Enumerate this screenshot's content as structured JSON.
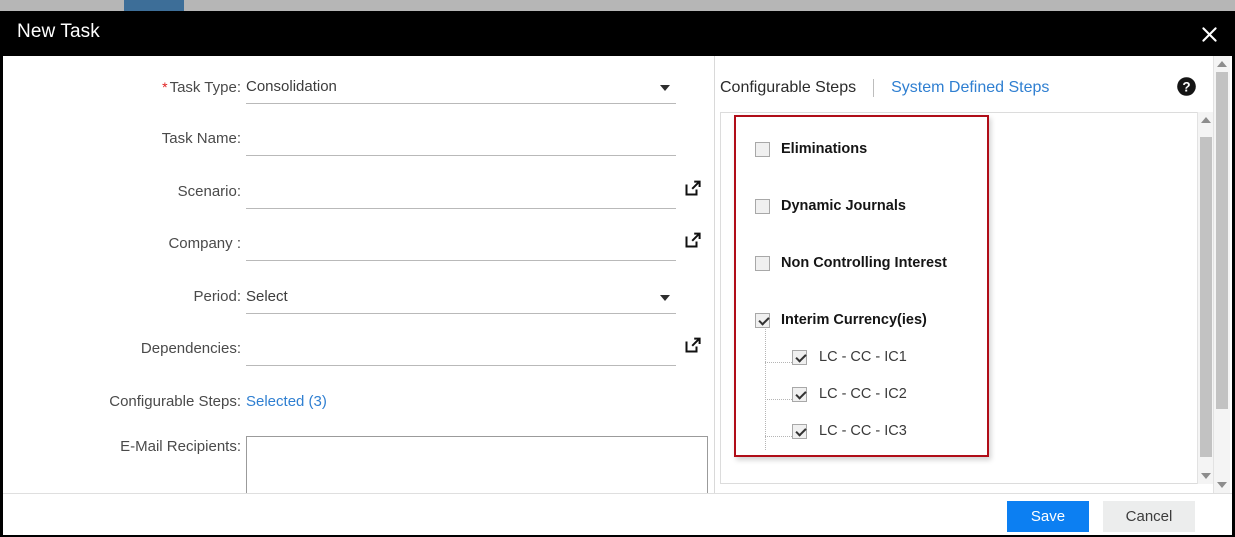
{
  "window": {
    "title": "New Task",
    "close_icon": "close-icon"
  },
  "form": {
    "rows": [
      {
        "label": "Task Type:",
        "required": true,
        "value": "Consolidation",
        "control": "dropdown"
      },
      {
        "label": "Task Name:",
        "required": false,
        "value": "",
        "control": "text"
      },
      {
        "label": "Scenario:",
        "required": false,
        "value": "",
        "control": "launch"
      },
      {
        "label": "Company :",
        "required": false,
        "value": "",
        "control": "launch"
      },
      {
        "label": "Period:",
        "required": false,
        "value": "Select",
        "control": "dropdown"
      },
      {
        "label": "Dependencies:",
        "required": false,
        "value": "",
        "control": "launch"
      },
      {
        "label": "Configurable Steps:",
        "required": false,
        "value": "Selected (3)",
        "control": "link"
      },
      {
        "label": "E-Mail Recipients:",
        "required": false,
        "value": "",
        "control": "textarea"
      }
    ]
  },
  "steps_panel": {
    "tabs": [
      {
        "label": "Configurable Steps",
        "active": true
      },
      {
        "label": "System Defined Steps",
        "active": false
      }
    ],
    "help_icon": "help-icon",
    "highlight_color": "#b00d18",
    "items": [
      {
        "label": "Eliminations",
        "checked": false,
        "level": 0
      },
      {
        "label": "Dynamic Journals",
        "checked": false,
        "level": 0
      },
      {
        "label": "Non Controlling Interest",
        "checked": false,
        "level": 0
      },
      {
        "label": "Interim Currency(ies)",
        "checked": true,
        "level": 0
      },
      {
        "label": "LC - CC - IC1",
        "checked": true,
        "level": 1
      },
      {
        "label": "LC - CC - IC2",
        "checked": true,
        "level": 1
      },
      {
        "label": "LC - CC - IC3",
        "checked": true,
        "level": 1
      }
    ]
  },
  "footer": {
    "save_label": "Save",
    "cancel_label": "Cancel",
    "save_color": "#0c7ff2"
  }
}
